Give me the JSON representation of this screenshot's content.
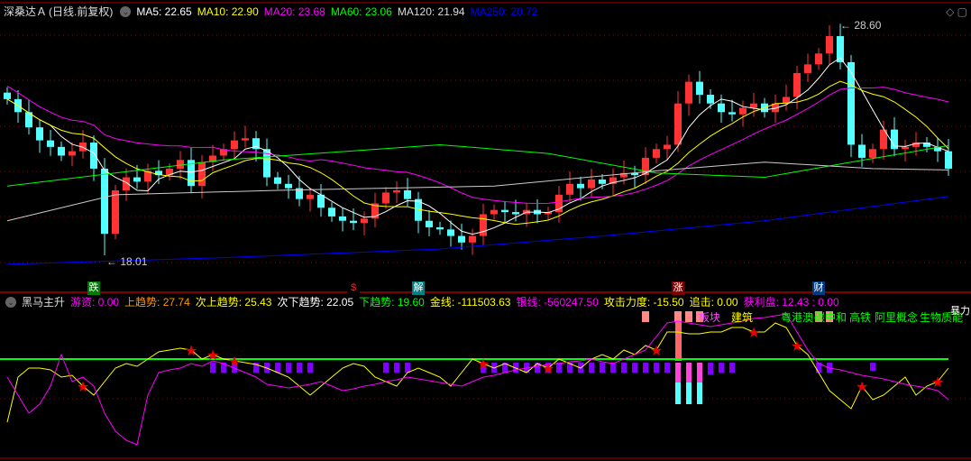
{
  "header": {
    "stock_name": "深桑达Ａ",
    "period": "(日线.前复权)",
    "ma": [
      {
        "label": "MA5: 22.65",
        "color": "#ffffff"
      },
      {
        "label": "MA10: 22.90",
        "color": "#ffff00"
      },
      {
        "label": "MA20: 23.68",
        "color": "#ff00ff"
      },
      {
        "label": "MA60: 23.06",
        "color": "#00ff00"
      },
      {
        "label": "MA120: 21.94",
        "color": "#dddddd"
      },
      {
        "label": "MA250: 20.72",
        "color": "#0000ff"
      }
    ]
  },
  "indicator_header": {
    "name": "黑马主升",
    "items": [
      {
        "label": "游资: 0.00",
        "color": "#ff00ff"
      },
      {
        "label": "上趋势: 27.74",
        "color": "#ff9900"
      },
      {
        "label": "次上趋势: 25.43",
        "color": "#ffff00"
      },
      {
        "label": "次下趋势: 22.05",
        "color": "#ffffff"
      },
      {
        "label": "下趋势: 19.60",
        "color": "#00ff00"
      },
      {
        "label": "金线: -111503.63",
        "color": "#ffff00"
      },
      {
        "label": "银线: -560247.50",
        "color": "#ff00ff"
      },
      {
        "label": "攻击力度: -15.50",
        "color": "#ffff00"
      },
      {
        "label": "追击: 0.00",
        "color": "#ffff00"
      },
      {
        "label": "获利盘: 12.43 : 0.00",
        "color": "#ff00ff"
      }
    ]
  },
  "sector_labels": [
    {
      "text": "板块",
      "color": "#ff44ff"
    },
    {
      "text": "建筑",
      "color": "#ffff00"
    },
    {
      "text": "粤港澳",
      "color": "#00ff00"
    },
    {
      "text": "碳中和",
      "color": "#00ff00"
    },
    {
      "text": "高铁",
      "color": "#00ff00"
    },
    {
      "text": "阿里概念",
      "color": "#00ff00"
    },
    {
      "text": "生物质能",
      "color": "#00ff00"
    },
    {
      "text": "暴力",
      "color": "#ffffff"
    }
  ],
  "event_tags": [
    {
      "text": "跌",
      "bg": "#007a00",
      "candle": 8
    },
    {
      "text": "$",
      "bg": "#000000",
      "candle": 32
    },
    {
      "text": "解",
      "bg": "#008080",
      "candle": 38
    },
    {
      "text": "涨",
      "bg": "#7a0000",
      "candle": 62
    },
    {
      "text": "财",
      "bg": "#003a80",
      "candle": 75
    }
  ],
  "chart_data": {
    "type": "candlestick",
    "price_range": [
      17.0,
      29.5
    ],
    "annotations": [
      {
        "text": "28.60",
        "label": "high"
      },
      {
        "text": "18.01",
        "label": "low"
      }
    ],
    "high_value": 28.6,
    "low_value": 18.01,
    "high_candle": 76,
    "low_candle": 9,
    "closes": [
      25.2,
      24.6,
      23.9,
      23.3,
      23.0,
      22.6,
      22.8,
      23.2,
      22.0,
      19.0,
      21.0,
      21.6,
      21.4,
      21.9,
      21.7,
      22.0,
      22.4,
      21.2,
      22.3,
      22.6,
      22.9,
      23.3,
      23.4,
      22.9,
      21.6,
      21.3,
      21.1,
      20.6,
      20.8,
      20.2,
      19.8,
      19.6,
      19.5,
      19.7,
      20.4,
      20.9,
      21.0,
      20.6,
      19.6,
      19.3,
      19.2,
      18.9,
      18.6,
      18.9,
      19.9,
      20.1,
      20.0,
      19.9,
      20.1,
      19.9,
      20.0,
      20.8,
      21.3,
      21.1,
      21.5,
      21.3,
      21.6,
      21.8,
      21.7,
      22.5,
      22.9,
      23.1,
      25.0,
      26.0,
      25.4,
      25.0,
      24.6,
      24.5,
      24.8,
      25.0,
      24.6,
      25.0,
      25.3,
      26.4,
      26.8,
      27.3,
      28.1,
      26.9,
      23.1,
      22.5,
      22.9,
      23.8,
      22.9,
      23.0,
      23.2,
      23.0,
      22.8,
      22.0
    ],
    "ma60": [
      [
        0,
        21.2
      ],
      [
        20,
        22.4
      ],
      [
        40,
        23.1
      ],
      [
        50,
        22.7
      ],
      [
        60,
        21.8
      ],
      [
        70,
        21.6
      ],
      [
        78,
        22.3
      ],
      [
        87,
        23.06
      ]
    ],
    "ma120": [
      [
        0,
        19.6
      ],
      [
        10,
        20.8
      ],
      [
        25,
        21.0
      ],
      [
        45,
        21.2
      ],
      [
        60,
        21.9
      ],
      [
        70,
        22.3
      ],
      [
        80,
        22.0
      ],
      [
        87,
        21.94
      ]
    ],
    "ma250": [
      [
        0,
        17.6
      ],
      [
        20,
        17.9
      ],
      [
        40,
        18.3
      ],
      [
        55,
        18.9
      ],
      [
        70,
        19.6
      ],
      [
        87,
        20.72
      ]
    ],
    "oscillator": {
      "zero_line": 0,
      "yellow": [
        -70,
        -20,
        -10,
        -10,
        -12,
        -20,
        -18,
        -30,
        -40,
        -25,
        -10,
        -5,
        -8,
        0,
        8,
        10,
        12,
        10,
        0,
        5,
        0,
        -2,
        -4,
        -6,
        -10,
        -15,
        -20,
        -30,
        -40,
        -30,
        -20,
        -10,
        -5,
        -8,
        -20,
        -25,
        -30,
        -15,
        -10,
        -15,
        -20,
        -30,
        -15,
        0,
        -5,
        -10,
        -5,
        -10,
        -15,
        -5,
        -10,
        0,
        -5,
        -10,
        0,
        5,
        0,
        10,
        5,
        15,
        10,
        30,
        30,
        28,
        28,
        30,
        30,
        35,
        35,
        30,
        30,
        40,
        35,
        15,
        5,
        -15,
        -35,
        -45,
        -55,
        -30,
        -45,
        -40,
        -30,
        -20,
        -40,
        -30,
        -25,
        -10
      ],
      "magenta": [
        -20,
        -40,
        -60,
        -50,
        -30,
        5,
        -25,
        -20,
        -30,
        -60,
        -80,
        -90,
        -95,
        -40,
        -15,
        -12,
        -10,
        -5,
        -8,
        -2,
        -5,
        -10,
        -15,
        -20,
        -28,
        -30,
        -32,
        -30,
        -28,
        -25,
        -30,
        -35,
        -33,
        -30,
        -28,
        -25,
        -23,
        -20,
        -22,
        -24,
        -26,
        -28,
        -30,
        -25,
        -20,
        -18,
        -15,
        -12,
        -10,
        -8,
        -6,
        -5,
        -3,
        -2,
        0,
        -3,
        -5,
        0,
        5,
        10,
        25,
        40,
        42,
        40,
        38,
        36,
        38,
        40,
        42,
        45,
        46,
        48,
        50,
        30,
        10,
        -5,
        -10,
        -12,
        -15,
        -18,
        -20,
        -22,
        -25,
        -28,
        -30,
        -32,
        -35,
        -45
      ],
      "bars": [
        0,
        0,
        0,
        0,
        0,
        0,
        0,
        0,
        0,
        0,
        0,
        0,
        0,
        0,
        0,
        0,
        0,
        0,
        0,
        -25,
        -25,
        -25,
        0,
        -25,
        -25,
        -25,
        -25,
        -25,
        -25,
        0,
        0,
        0,
        0,
        0,
        0,
        -25,
        -25,
        -25,
        0,
        0,
        0,
        0,
        0,
        0,
        -25,
        -25,
        -25,
        -25,
        -25,
        -25,
        -25,
        -25,
        -25,
        -25,
        -25,
        -25,
        -25,
        -25,
        -25,
        -25,
        -25,
        -25,
        -50,
        -50,
        -50,
        -30,
        -25,
        -25,
        0,
        0,
        0,
        0,
        0,
        0,
        0,
        -25,
        -25,
        0,
        0,
        0,
        -20,
        0,
        0,
        0,
        0,
        0,
        0,
        0
      ],
      "stars": [
        7,
        17,
        19,
        21,
        44,
        50,
        60,
        69,
        73,
        79,
        86
      ]
    }
  },
  "colors": {
    "up": "#ff3333",
    "down": "#54ffff",
    "grid": "#8b0000",
    "zero": "#00ff00",
    "bar": "#8000ff"
  }
}
